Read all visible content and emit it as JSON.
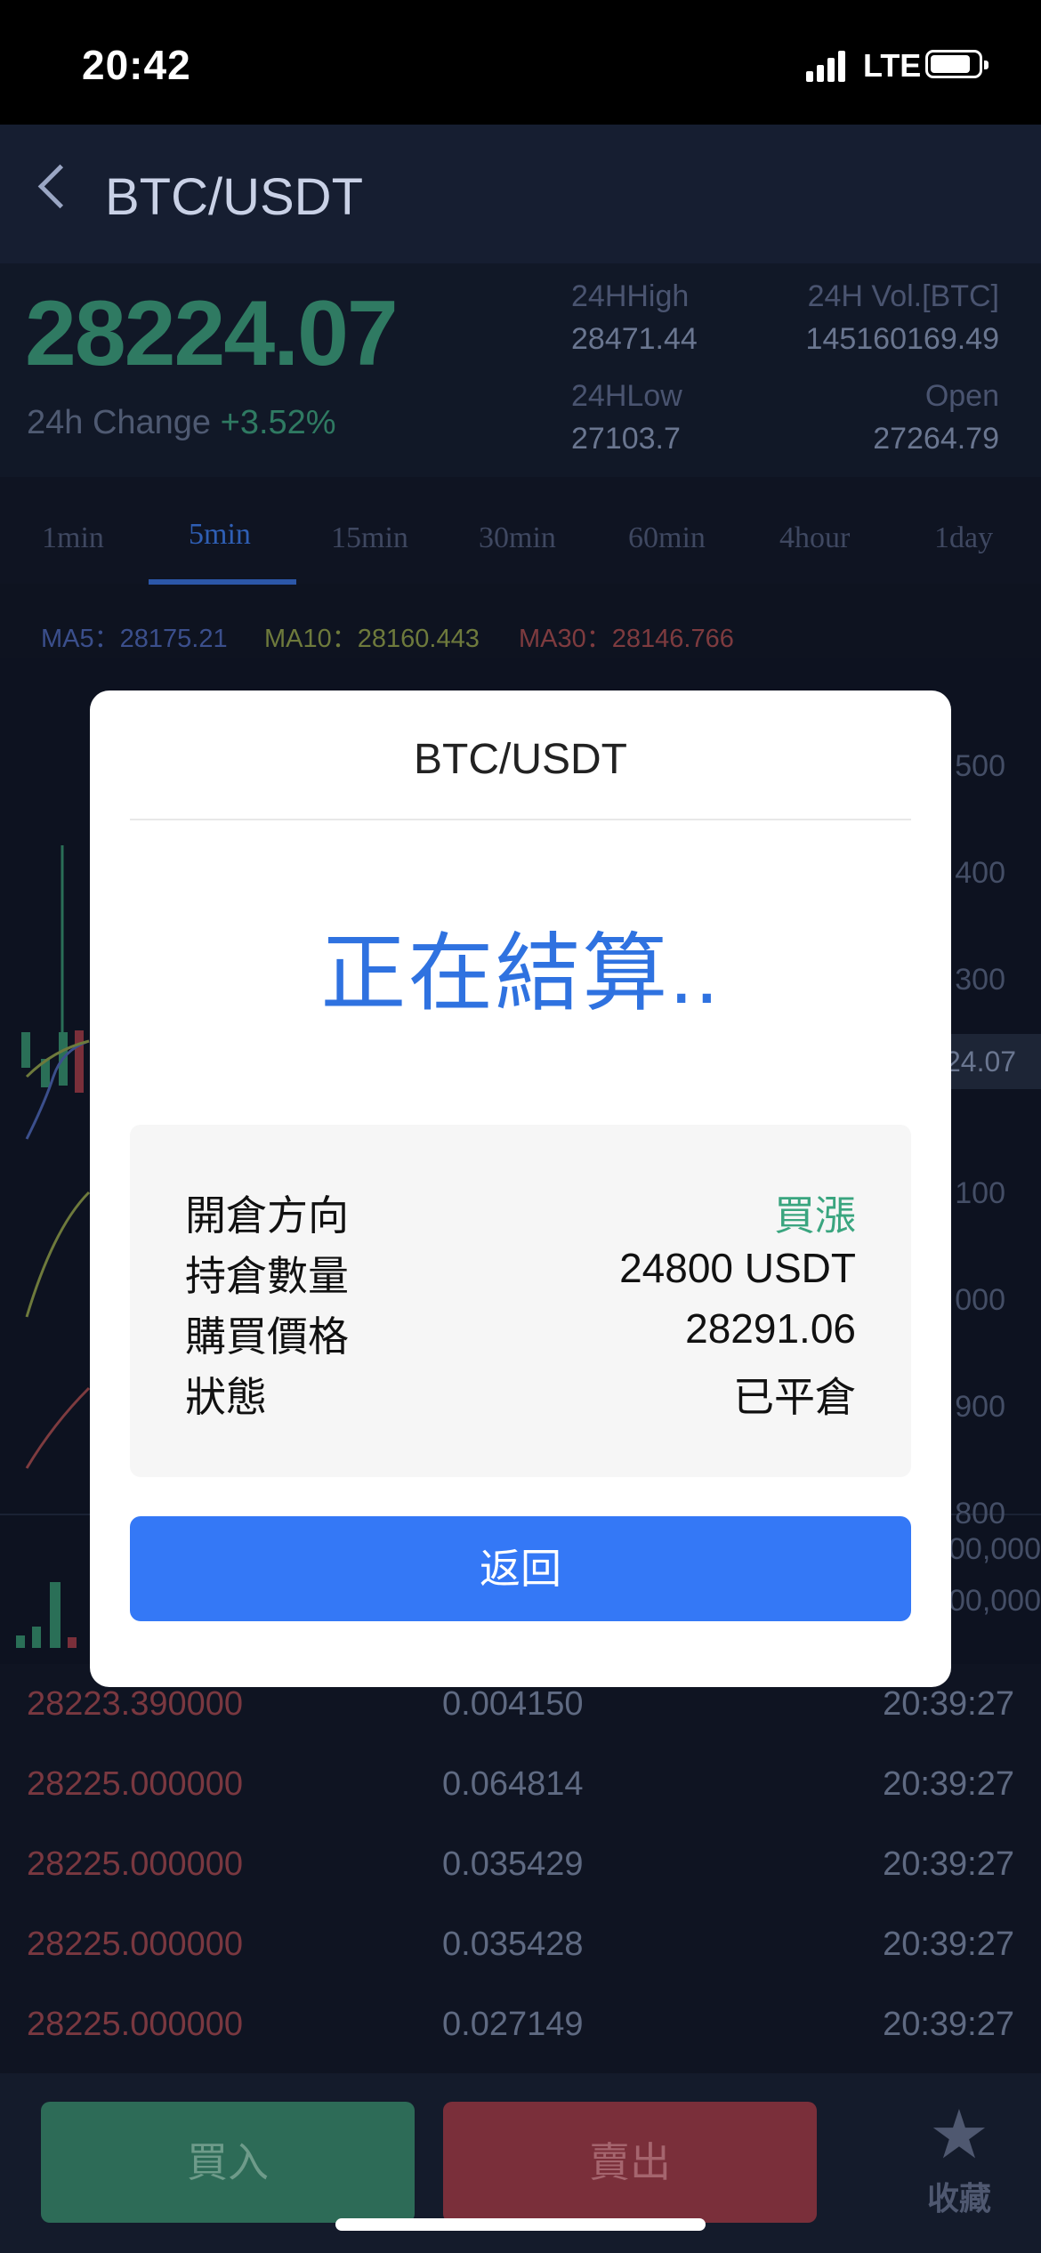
{
  "status_bar": {
    "time": "20:42",
    "network": "LTE"
  },
  "nav": {
    "title": "BTC/USDT"
  },
  "ticker": {
    "price": "28224.07",
    "change_label": "24h Change",
    "change_value": "+3.52%",
    "high_label": "24HHigh",
    "high_value": "28471.44",
    "vol_label": "24H Vol.[BTC]",
    "vol_value": "145160169.49",
    "low_label": "24HLow",
    "low_value": "27103.7",
    "open_label": "Open",
    "open_value": "27264.79",
    "up_color": "#2f7a62"
  },
  "intervals": [
    {
      "label": "1min"
    },
    {
      "label": "5min"
    },
    {
      "label": "15min"
    },
    {
      "label": "30min"
    },
    {
      "label": "60min"
    },
    {
      "label": "4hour"
    },
    {
      "label": "1day"
    }
  ],
  "active_interval": "5min",
  "ma": {
    "ma5": "MA5：28175.21",
    "ma10": "MA10：28160.443",
    "ma30": "MA30：28146.766"
  },
  "axis_fragments": [
    "500",
    "400",
    "300",
    "24.07",
    "100",
    "000",
    "900",
    "800",
    "00,000",
    "00,000"
  ],
  "trades": [
    {
      "price": "28223.390000",
      "amount": "0.004150",
      "time": "20:39:27"
    },
    {
      "price": "28225.000000",
      "amount": "0.064814",
      "time": "20:39:27"
    },
    {
      "price": "28225.000000",
      "amount": "0.035429",
      "time": "20:39:27"
    },
    {
      "price": "28225.000000",
      "amount": "0.035428",
      "time": "20:39:27"
    },
    {
      "price": "28225.000000",
      "amount": "0.027149",
      "time": "20:39:27"
    }
  ],
  "bottom": {
    "buy": "買入",
    "sell": "賣出",
    "favorite": "收藏"
  },
  "modal": {
    "title": "BTC/USDT",
    "status": "正在結算..",
    "rows": [
      {
        "label": "開倉方向",
        "value": "買漲",
        "color": "#3aa57f"
      },
      {
        "label": "持倉數量",
        "value": "24800 USDT"
      },
      {
        "label": "購買價格",
        "value": "28291.06"
      },
      {
        "label": "狀態",
        "value": "已平倉"
      }
    ],
    "button": "返回",
    "accent": "#3478f6"
  }
}
